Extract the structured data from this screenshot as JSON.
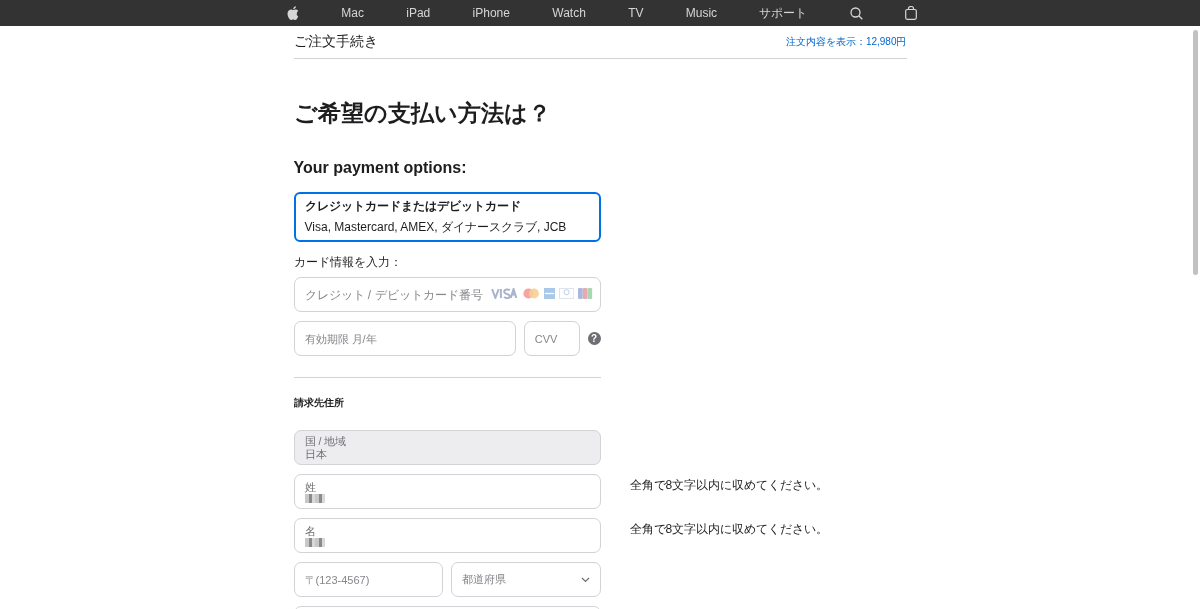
{
  "nav": {
    "items": [
      "Mac",
      "iPad",
      "iPhone",
      "Watch",
      "TV",
      "Music",
      "サポート"
    ]
  },
  "header": {
    "title": "ご注文手続き",
    "summary_link": "注文内容を表示：12,980円"
  },
  "heading": "ご希望の支払い方法は？",
  "subheading": "Your payment options:",
  "payment_options": [
    {
      "title": "クレジットカードまたはデビットカード",
      "subtitle": "Visa, Mastercard, AMEX, ダイナースクラブ, JCB",
      "selected": true
    }
  ],
  "card_section": {
    "label": "カード情報を入力：",
    "card_number": {
      "placeholder": "クレジット / デビットカード番号"
    },
    "expiry": {
      "placeholder": "有効期限 月/年"
    },
    "cvv": {
      "placeholder": "CVV",
      "help": "?"
    }
  },
  "billing": {
    "title": "請求先住所",
    "fields": [
      {
        "kind": "text",
        "label": "国 / 地域",
        "value": "日本",
        "disabled": true,
        "redacted": false
      },
      {
        "kind": "text",
        "label": "姓",
        "disabled": false,
        "redacted": true,
        "hint": "全角で8文字以内に収めてください。"
      },
      {
        "kind": "text",
        "label": "名",
        "disabled": false,
        "redacted": true,
        "hint": "全角で8文字以内に収めてください。"
      },
      {
        "kind": "pair",
        "left": {
          "placeholder": "〒(123-4567)"
        },
        "right": {
          "placeholder": "都道府県"
        }
      }
    ]
  }
}
